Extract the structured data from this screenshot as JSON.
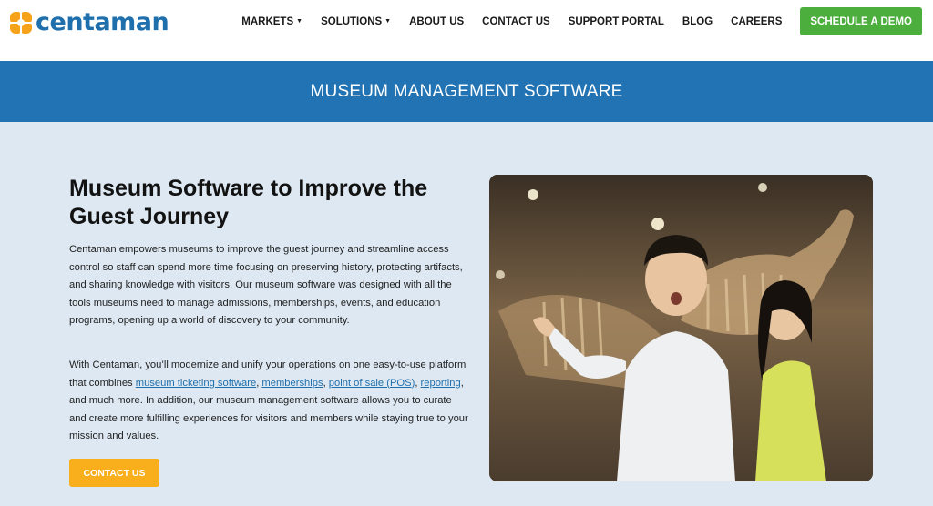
{
  "brand": {
    "name": "centaman",
    "accent": "#1f6fad",
    "logo_color": "#f7a21b"
  },
  "nav": {
    "items": [
      {
        "label": "MARKETS",
        "dropdown": true
      },
      {
        "label": "SOLUTIONS",
        "dropdown": true
      },
      {
        "label": "ABOUT US",
        "dropdown": false
      },
      {
        "label": "CONTACT US",
        "dropdown": false
      },
      {
        "label": "SUPPORT PORTAL",
        "dropdown": false
      },
      {
        "label": "BLOG",
        "dropdown": false
      },
      {
        "label": "CAREERS",
        "dropdown": false
      }
    ],
    "cta_label": "SCHEDULE A DEMO",
    "cta_color": "#4caf3d"
  },
  "banner": {
    "title": "MUSEUM MANAGEMENT SOFTWARE",
    "color": "#2273b3"
  },
  "main": {
    "heading": "Museum Software to Improve the Guest Journey",
    "paragraph1": "Centaman empowers museums to improve the guest journey and streamline access control so staff can spend more time focusing on preserving history, protecting artifacts, and sharing knowledge with visitors. Our museum software was designed with all the tools museums need to manage admissions, memberships, events, and education programs, opening up a world of discovery to your community.",
    "paragraph2": {
      "intro": "With Centaman, you’ll modernize and unify your operations on one easy-to-use platform that combines ",
      "link1": "museum ticketing software",
      "sep1": ", ",
      "link2": "memberships",
      "sep2": ", ",
      "link3": "point of sale (POS)",
      "sep3": ", ",
      "link4": "reporting",
      "outro": ", and much more. In addition, our museum management software allows you to curate and create more fulfilling experiences for visitors and members while staying true to your mission and values."
    },
    "contact_button": "CONTACT US",
    "contact_color": "#f9ae1b",
    "background": "#dde8f2"
  }
}
